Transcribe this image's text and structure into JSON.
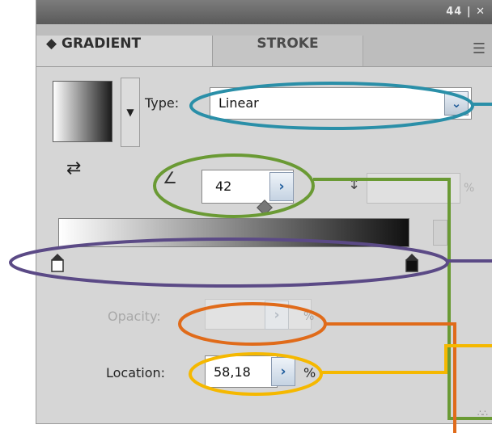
{
  "window": {
    "controls": "44 | ✕"
  },
  "tabs": [
    {
      "label": "◆ GRADIENT",
      "active": true
    },
    {
      "label": "STROKE",
      "active": false
    }
  ],
  "menu_icon": "panel-menu-icon",
  "type": {
    "label": "Type:",
    "value": "Linear"
  },
  "angle": {
    "value": "42"
  },
  "aspect": {
    "unit": "%"
  },
  "opacity": {
    "label": "Opacity:",
    "unit": "%"
  },
  "location": {
    "label": "Location:",
    "value": "58,18",
    "unit": "%"
  },
  "colors": {
    "annotation_teal": "#2a8fa8",
    "annotation_green": "#6a9a34",
    "annotation_purple": "#5b4a86",
    "annotation_orange": "#e06b1a",
    "annotation_yellow": "#f5b800"
  }
}
